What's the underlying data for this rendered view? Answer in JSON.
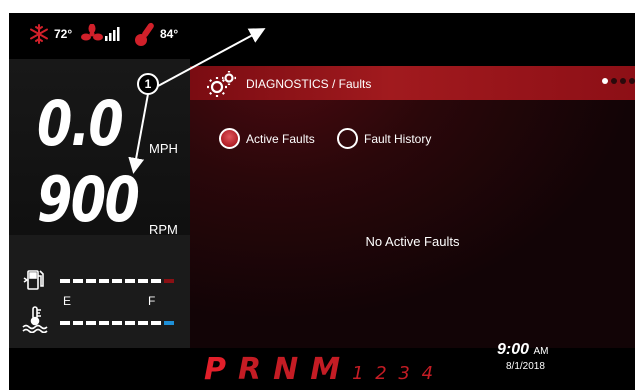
{
  "status": {
    "climate_temp": "72°",
    "outside_temp": "84°",
    "icons": [
      "snowflake-icon",
      "fan-icon",
      "signal-bars-icon",
      "thermometer-icon"
    ]
  },
  "gauges": {
    "speed_value": "0.0",
    "speed_unit": "MPH",
    "rpm_value": "900",
    "rpm_unit": "RPM",
    "fuel_empty_label": "E",
    "fuel_full_label": "F",
    "icons": [
      "fuel-pump-icon",
      "coolant-temp-icon"
    ]
  },
  "diagnostics": {
    "title": "DIAGNOSTICS / Faults",
    "tabs": [
      {
        "label": "Active Faults",
        "selected": true
      },
      {
        "label": "Fault History",
        "selected": false
      }
    ],
    "empty_message": "No Active Faults",
    "page_indicator": {
      "total": 4,
      "current": 1
    }
  },
  "transmission": {
    "gears": [
      "P",
      "R",
      "N",
      "M"
    ],
    "manual_gears": "1 2 3 4",
    "active_gear": "P"
  },
  "clock": {
    "time": "9:00",
    "ampm": "AM",
    "date": "8/1/2018"
  },
  "callout": {
    "number": "1"
  },
  "colors": {
    "accent_red": "#c41c24",
    "blue_gauge": "#1e90d8",
    "dark_red": "#7a0c12"
  }
}
